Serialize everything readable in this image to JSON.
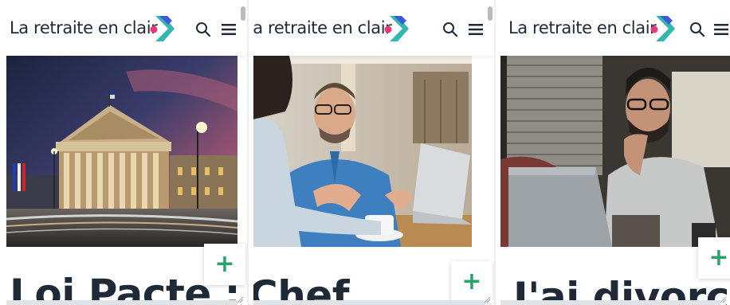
{
  "screens": [
    {
      "brand": "La retraite en clair",
      "title": "Loi Pacte :",
      "fab": "+"
    },
    {
      "brand": "La retraite en clair",
      "title": "Chef",
      "fab": "+"
    },
    {
      "brand": "La retraite en clair",
      "title": "J'ai divorcé",
      "fab": "+"
    }
  ],
  "icons": {
    "search": "search-icon",
    "menu": "menu-icon",
    "logo": "logo-arrow-icon"
  },
  "colors": {
    "brand_text": "#1f2a37",
    "accent_green": "#2aa36a",
    "logo_teal": "#35b7b1",
    "logo_blue": "#3d5bd6",
    "logo_pink": "#e8397a"
  }
}
